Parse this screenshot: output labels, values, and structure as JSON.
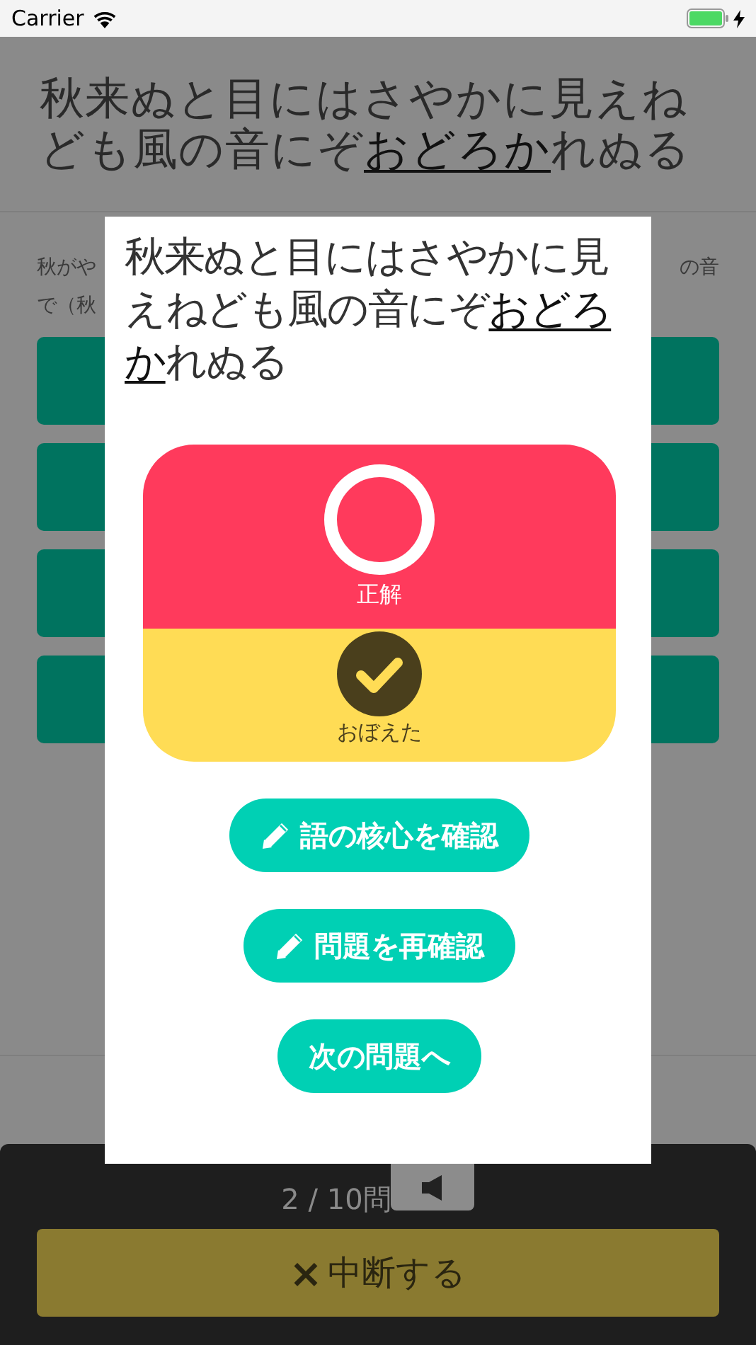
{
  "status_bar": {
    "carrier": "Carrier",
    "charging": true
  },
  "question": {
    "before": "秋来ぬと目にはさやかに見えねども風の音にぞ",
    "underlined": "おどろか",
    "after": "れぬる"
  },
  "explanation": {
    "left_fragments": [
      "秋がや",
      "で（秋"
    ],
    "right_fragments": [
      "の音"
    ]
  },
  "answer_choices": [
    {
      "kind": "button"
    },
    {
      "kind": "button"
    },
    {
      "kind": "button"
    },
    {
      "kind": "button"
    }
  ],
  "progress": {
    "text": "2 / 10問"
  },
  "abort_button": {
    "label": "中断する",
    "icon": "×"
  },
  "modal": {
    "question": {
      "before": "秋来ぬと目にはさやかに見えねども風の音にぞ",
      "underlined": "おどろか",
      "after": "れぬる"
    },
    "result": {
      "kind": "correct",
      "label": "正解"
    },
    "memorized": {
      "label": "おぼえた",
      "checked": true
    },
    "buttons": [
      {
        "label": "語の核心を確認",
        "kind": "icon_button"
      },
      {
        "label": "問題を再確認",
        "kind": "icon_button"
      },
      {
        "label": "次の問題へ",
        "kind": "text_button"
      }
    ]
  }
}
